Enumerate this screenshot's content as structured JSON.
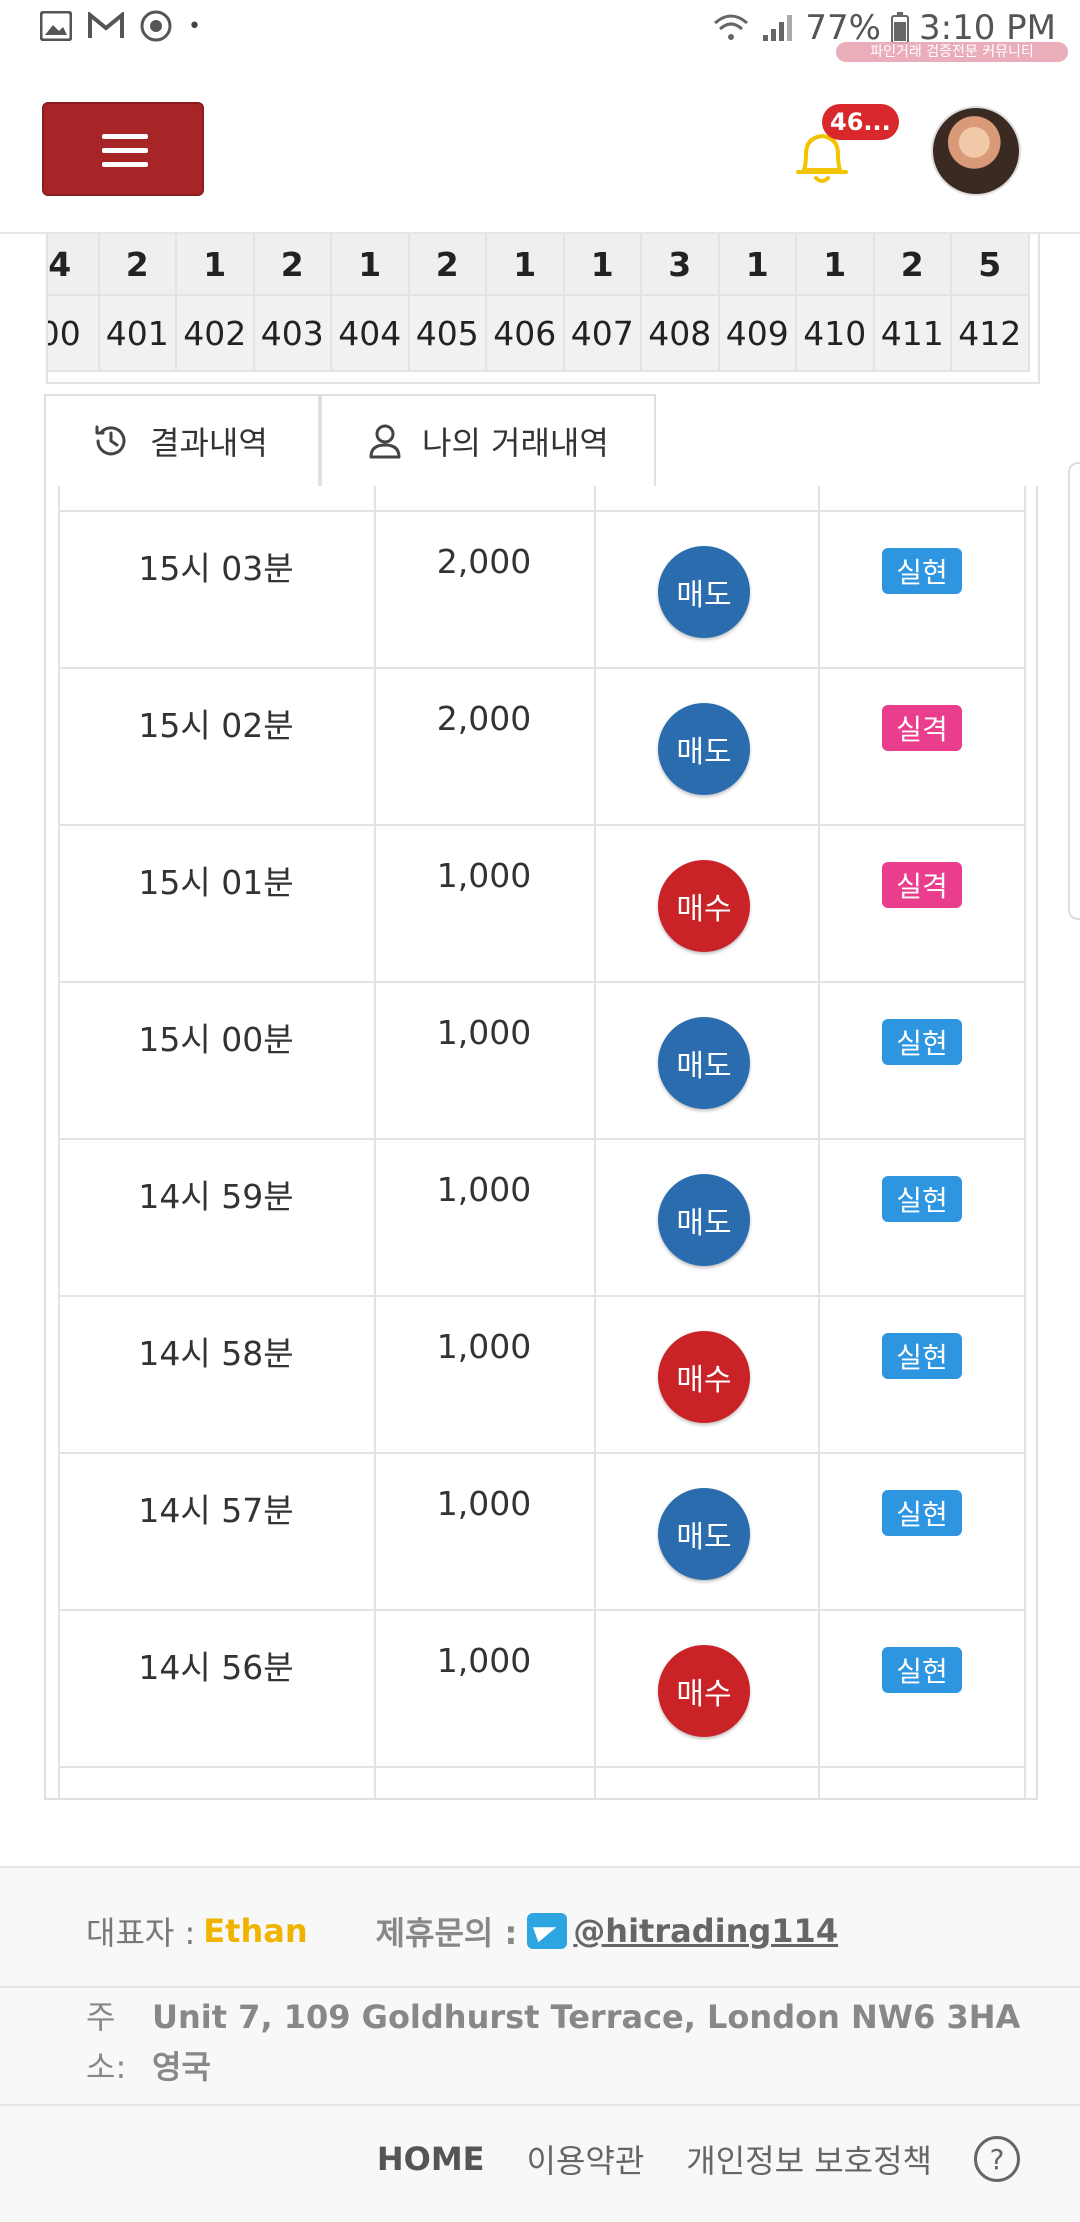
{
  "status_bar": {
    "battery": "77%",
    "time": "3:10 PM",
    "watermark": "파인거래 검증전문 커뮤니티"
  },
  "header": {
    "notification_count": "46..."
  },
  "number_strip": {
    "top": [
      "4",
      "2",
      "1",
      "2",
      "1",
      "2",
      "1",
      "1",
      "3",
      "1",
      "1",
      "2",
      "5"
    ],
    "bottom": [
      "00",
      "401",
      "402",
      "403",
      "404",
      "405",
      "406",
      "407",
      "408",
      "409",
      "410",
      "411",
      "412"
    ]
  },
  "tabs": [
    {
      "label": "결과내역"
    },
    {
      "label": "나의 거래내역"
    }
  ],
  "trades": [
    {
      "time": "15시 03분",
      "amount": "2,000",
      "side": "매도",
      "result": "실현"
    },
    {
      "time": "15시 02분",
      "amount": "2,000",
      "side": "매도",
      "result": "실격"
    },
    {
      "time": "15시 01분",
      "amount": "1,000",
      "side": "매수",
      "result": "실격"
    },
    {
      "time": "15시 00분",
      "amount": "1,000",
      "side": "매도",
      "result": "실현"
    },
    {
      "time": "14시 59분",
      "amount": "1,000",
      "side": "매도",
      "result": "실현"
    },
    {
      "time": "14시 58분",
      "amount": "1,000",
      "side": "매수",
      "result": "실현"
    },
    {
      "time": "14시 57분",
      "amount": "1,000",
      "side": "매도",
      "result": "실현"
    },
    {
      "time": "14시 56분",
      "amount": "1,000",
      "side": "매수",
      "result": "실현"
    }
  ],
  "footer": {
    "ceo_label": "대표자 :",
    "ceo_name": "Ethan",
    "partner_label": "제휴문의 :",
    "partner_handle": "@hitrading114",
    "address_label_1": "주",
    "address_label_2": "소:",
    "address_line_1": "Unit 7, 109 Goldhurst Terrace, London NW6 3HA",
    "address_line_2": "영국",
    "links": {
      "home": "HOME",
      "terms": "이용약관",
      "privacy": "개인정보 보호정책",
      "help": "?"
    }
  },
  "colors": {
    "menu_button": "#a72427",
    "sell": "#2a6cad",
    "buy": "#c92227",
    "result_realized": "#2e95e0",
    "result_disqualified": "#ea3d8e",
    "ceo_name": "#f0b400"
  }
}
